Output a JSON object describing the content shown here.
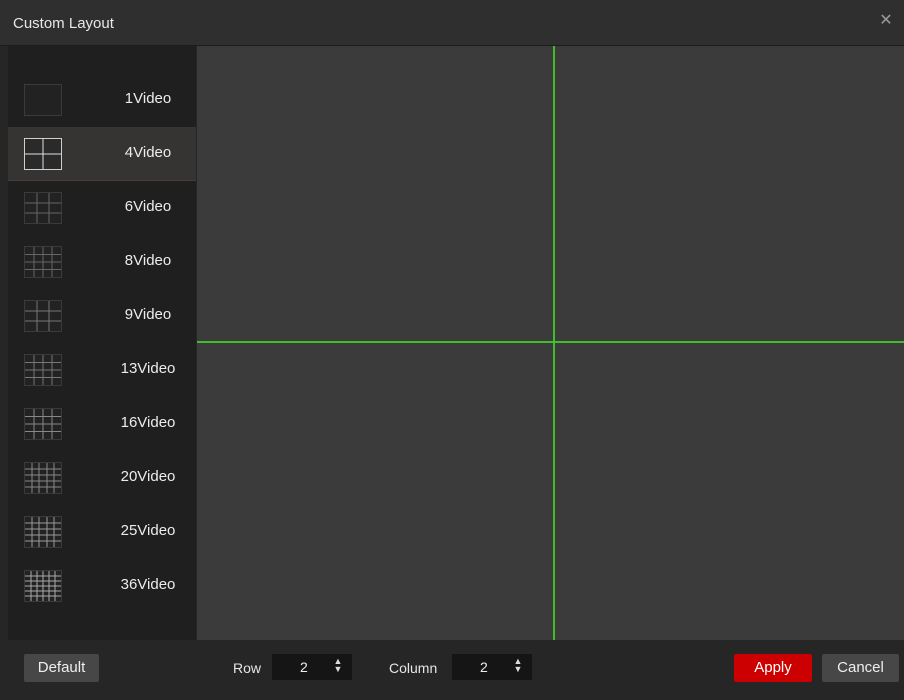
{
  "dialog": {
    "title": "Custom Layout",
    "close_icon": "close-icon"
  },
  "layouts": [
    {
      "label": "1Video",
      "selected": false,
      "grid": "1x1"
    },
    {
      "label": "4Video",
      "selected": true,
      "grid": "2x2"
    },
    {
      "label": "6Video",
      "selected": false,
      "grid": "3x3-merged"
    },
    {
      "label": "8Video",
      "selected": false,
      "grid": "4x4-merged"
    },
    {
      "label": "9Video",
      "selected": false,
      "grid": "3x3"
    },
    {
      "label": "13Video",
      "selected": false,
      "grid": "4x4-merged"
    },
    {
      "label": "16Video",
      "selected": false,
      "grid": "4x4"
    },
    {
      "label": "20Video",
      "selected": false,
      "grid": "5x5-merged"
    },
    {
      "label": "25Video",
      "selected": false,
      "grid": "5x5"
    },
    {
      "label": "36Video",
      "selected": false,
      "grid": "6x6"
    }
  ],
  "preview": {
    "rows": 2,
    "columns": 2,
    "line_color": "#3fbf2a"
  },
  "footer": {
    "default_label": "Default",
    "row_label": "Row",
    "row_value": "2",
    "column_label": "Column",
    "column_value": "2",
    "apply_label": "Apply",
    "cancel_label": "Cancel"
  },
  "colors": {
    "apply": "#cc0000",
    "accent_line": "#3fbf2a"
  }
}
